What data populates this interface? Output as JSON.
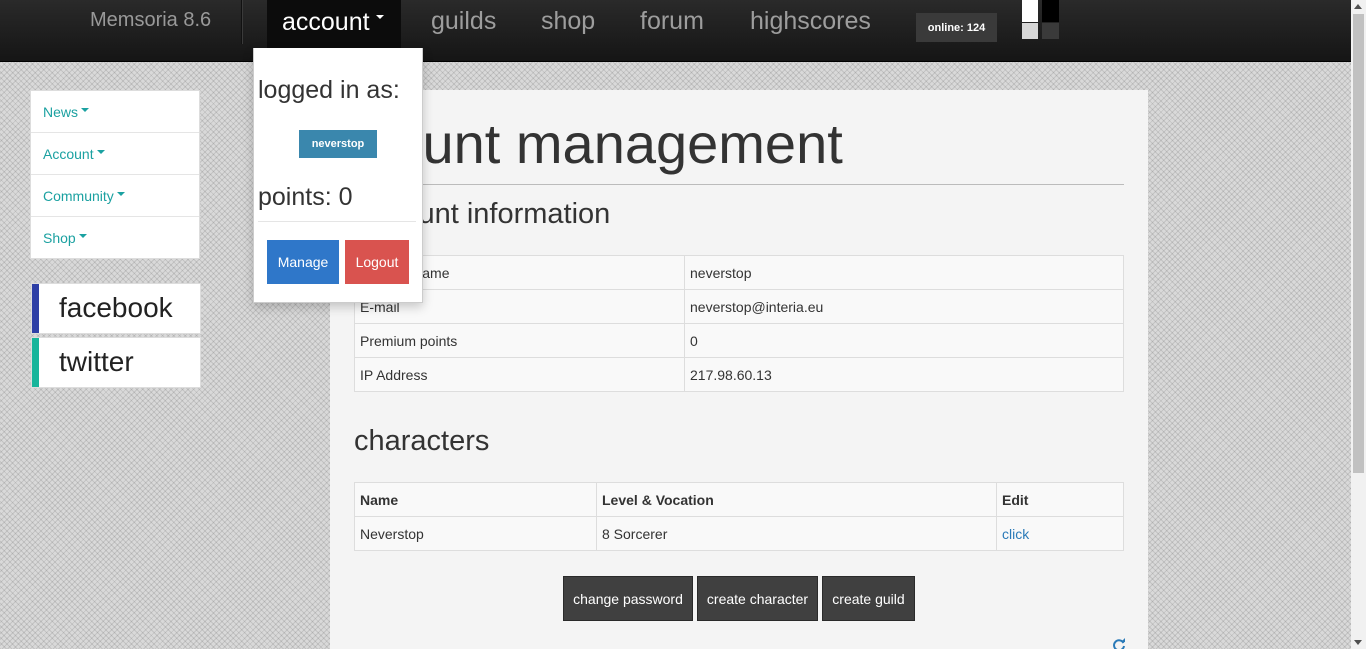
{
  "nav": {
    "brand": "Memsoria 8.6",
    "items": [
      "account",
      "guilds",
      "shop",
      "forum",
      "highscores"
    ],
    "online": "online: 124"
  },
  "dropdown": {
    "logged_in_label": "logged in as:",
    "username": "neverstop",
    "points_label": "points: 0",
    "manage_label": "Manage",
    "logout_label": "Logout"
  },
  "sidebar": {
    "items": [
      "News",
      "Account",
      "Community",
      "Shop"
    ],
    "social": [
      "facebook",
      "twitter"
    ]
  },
  "main": {
    "title": "Account management",
    "info_title": "Account information",
    "info_rows": [
      [
        "Account name",
        "neverstop"
      ],
      [
        "E-mail",
        "neverstop@interia.eu"
      ],
      [
        "Premium points",
        "0"
      ],
      [
        "IP Address",
        "217.98.60.13"
      ]
    ],
    "characters_title": "characters",
    "char_headers": [
      "Name",
      "Level & Vocation",
      "Edit"
    ],
    "char_rows": [
      [
        "Neverstop",
        "8 Sorcerer",
        "click"
      ]
    ],
    "buttons": [
      "change password",
      "create character",
      "create guild"
    ]
  },
  "colors": {
    "accent": "#1ba1a1",
    "manage": "#2f77c9",
    "logout": "#d9534f",
    "user_badge": "#3a87ad",
    "facebook_bar": "#2e3fa6",
    "twitter_bar": "#17b59b"
  }
}
